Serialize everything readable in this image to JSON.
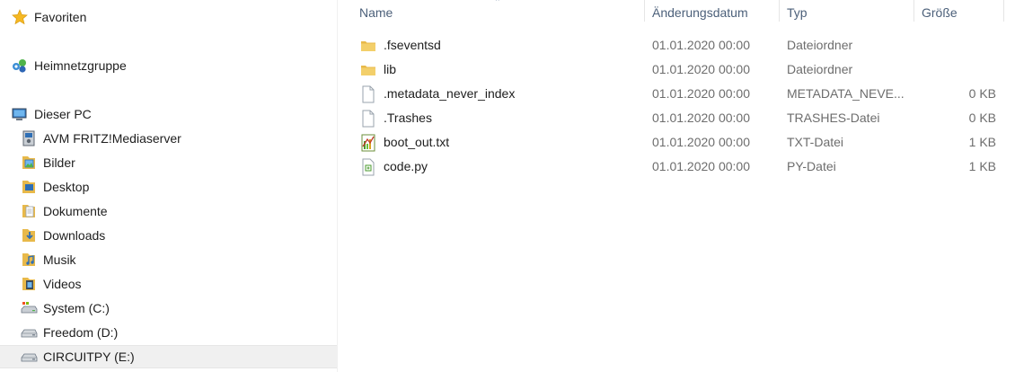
{
  "nav": {
    "favorites": "Favoriten",
    "homegroup": "Heimnetzgruppe",
    "this_pc": "Dieser PC",
    "children": [
      {
        "label": "AVM FRITZ!Mediaserver",
        "icon": "media-server-icon"
      },
      {
        "label": "Bilder",
        "icon": "pictures-folder-icon"
      },
      {
        "label": "Desktop",
        "icon": "desktop-folder-icon"
      },
      {
        "label": "Dokumente",
        "icon": "documents-folder-icon"
      },
      {
        "label": "Downloads",
        "icon": "downloads-folder-icon"
      },
      {
        "label": "Musik",
        "icon": "music-folder-icon"
      },
      {
        "label": "Videos",
        "icon": "videos-folder-icon"
      },
      {
        "label": "System (C:)",
        "icon": "system-drive-icon"
      },
      {
        "label": "Freedom (D:)",
        "icon": "drive-icon"
      },
      {
        "label": "CIRCUITPY (E:)",
        "icon": "drive-icon",
        "selected": true
      }
    ]
  },
  "columns": {
    "name": "Name",
    "date": "Änderungsdatum",
    "type": "Typ",
    "size": "Größe"
  },
  "files": [
    {
      "name": ".fseventsd",
      "date": "01.01.2020 00:00",
      "type": "Dateiordner",
      "size": "",
      "icon": "folder-icon"
    },
    {
      "name": "lib",
      "date": "01.01.2020 00:00",
      "type": "Dateiordner",
      "size": "",
      "icon": "folder-icon"
    },
    {
      "name": ".metadata_never_index",
      "date": "01.01.2020 00:00",
      "type": "METADATA_NEVE...",
      "size": "0 KB",
      "icon": "file-icon"
    },
    {
      "name": ".Trashes",
      "date": "01.01.2020 00:00",
      "type": "TRASHES-Datei",
      "size": "0 KB",
      "icon": "file-icon"
    },
    {
      "name": "boot_out.txt",
      "date": "01.01.2020 00:00",
      "type": "TXT-Datei",
      "size": "1 KB",
      "icon": "text-file-icon"
    },
    {
      "name": "code.py",
      "date": "01.01.2020 00:00",
      "type": "PY-Datei",
      "size": "1 KB",
      "icon": "python-file-icon"
    }
  ],
  "colors": {
    "header_text": "#4c607a",
    "folder": "#e8b94a",
    "selected_bg": "#f0f0f0"
  }
}
